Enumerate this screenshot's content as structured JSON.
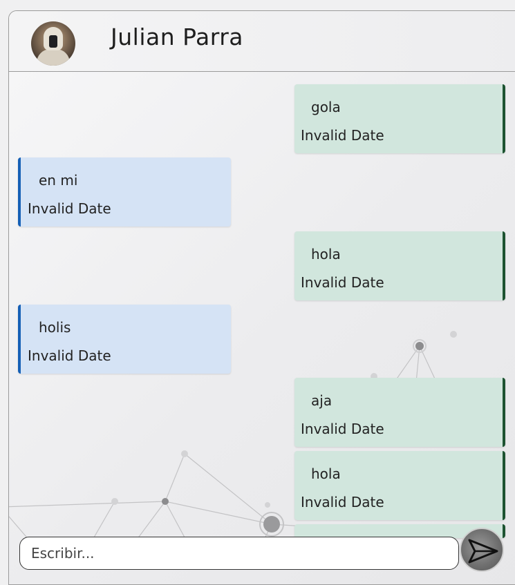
{
  "chat": {
    "contact_name": "Julian Parra",
    "avatar_icon": "user-avatar-photo"
  },
  "messages": [
    {
      "direction": "out",
      "text": "gola",
      "time": "Invalid Date"
    },
    {
      "direction": "in",
      "text": "en mi",
      "time": "Invalid Date"
    },
    {
      "direction": "out",
      "text": "hola",
      "time": "Invalid Date"
    },
    {
      "direction": "in",
      "text": "holis",
      "time": "Invalid Date"
    },
    {
      "direction": "out",
      "text": "aja",
      "time": "Invalid Date"
    },
    {
      "direction": "out",
      "text": "hola",
      "time": "Invalid Date"
    }
  ],
  "composer": {
    "placeholder": "Escribir...",
    "value": "",
    "send_icon": "send-icon"
  },
  "colors": {
    "outgoing_bg": "#d1e6dd",
    "outgoing_accent": "#1d5331",
    "incoming_bg": "#d5e3f5",
    "incoming_accent": "#1660b6"
  }
}
